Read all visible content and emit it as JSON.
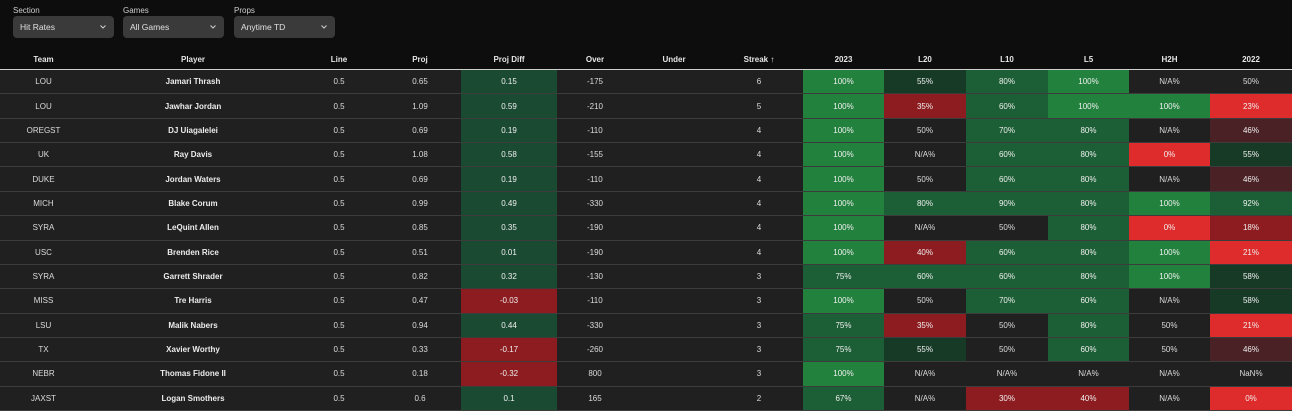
{
  "filters": [
    {
      "label": "Section",
      "value": "Hit Rates"
    },
    {
      "label": "Games",
      "value": "All Games"
    },
    {
      "label": "Props",
      "value": "Anytime TD"
    }
  ],
  "columns": [
    "Team",
    "Player",
    "Line",
    "Proj",
    "Proj Diff",
    "Over",
    "Under",
    "Streak ↑",
    "2023",
    "L20",
    "L10",
    "L5",
    "H2H",
    "2022"
  ],
  "colors": {
    "background": "#0d0d0d",
    "row": "#202020",
    "red_dark": "#4a2124",
    "red_mid": "#8c1c1f",
    "red_bright": "#de2b2b",
    "green_dark": "#173a27",
    "green_mid": "#1c5e35",
    "green_bright": "#22813d",
    "green_diff": "#1b4a33"
  },
  "rows": [
    {
      "team": "LOU",
      "player": "Jamari Thrash",
      "line": "0.5",
      "proj": "0.65",
      "diff": "0.15",
      "over": "-175",
      "under": "",
      "streak": "6",
      "y2023": "100%",
      "l20": "55%",
      "l10": "80%",
      "l5": "100%",
      "h2h": "N/A%",
      "y2022": "50%"
    },
    {
      "team": "LOU",
      "player": "Jawhar Jordan",
      "line": "0.5",
      "proj": "1.09",
      "diff": "0.59",
      "over": "-210",
      "under": "",
      "streak": "5",
      "y2023": "100%",
      "l20": "35%",
      "l10": "60%",
      "l5": "100%",
      "h2h": "100%",
      "y2022": "23%"
    },
    {
      "team": "OREGST",
      "player": "DJ Uiagalelei",
      "line": "0.5",
      "proj": "0.69",
      "diff": "0.19",
      "over": "-110",
      "under": "",
      "streak": "4",
      "y2023": "100%",
      "l20": "50%",
      "l10": "70%",
      "l5": "80%",
      "h2h": "N/A%",
      "y2022": "46%"
    },
    {
      "team": "UK",
      "player": "Ray Davis",
      "line": "0.5",
      "proj": "1.08",
      "diff": "0.58",
      "over": "-155",
      "under": "",
      "streak": "4",
      "y2023": "100%",
      "l20": "N/A%",
      "l10": "60%",
      "l5": "80%",
      "h2h": "0%",
      "y2022": "55%"
    },
    {
      "team": "DUKE",
      "player": "Jordan Waters",
      "line": "0.5",
      "proj": "0.69",
      "diff": "0.19",
      "over": "-110",
      "under": "",
      "streak": "4",
      "y2023": "100%",
      "l20": "50%",
      "l10": "60%",
      "l5": "80%",
      "h2h": "N/A%",
      "y2022": "46%"
    },
    {
      "team": "MICH",
      "player": "Blake Corum",
      "line": "0.5",
      "proj": "0.99",
      "diff": "0.49",
      "over": "-330",
      "under": "",
      "streak": "4",
      "y2023": "100%",
      "l20": "80%",
      "l10": "90%",
      "l5": "80%",
      "h2h": "100%",
      "y2022": "92%"
    },
    {
      "team": "SYRA",
      "player": "LeQuint Allen",
      "line": "0.5",
      "proj": "0.85",
      "diff": "0.35",
      "over": "-190",
      "under": "",
      "streak": "4",
      "y2023": "100%",
      "l20": "N/A%",
      "l10": "50%",
      "l5": "80%",
      "h2h": "0%",
      "y2022": "18%"
    },
    {
      "team": "USC",
      "player": "Brenden Rice",
      "line": "0.5",
      "proj": "0.51",
      "diff": "0.01",
      "over": "-190",
      "under": "",
      "streak": "4",
      "y2023": "100%",
      "l20": "40%",
      "l10": "60%",
      "l5": "80%",
      "h2h": "100%",
      "y2022": "21%"
    },
    {
      "team": "SYRA",
      "player": "Garrett Shrader",
      "line": "0.5",
      "proj": "0.82",
      "diff": "0.32",
      "over": "-130",
      "under": "",
      "streak": "3",
      "y2023": "75%",
      "l20": "60%",
      "l10": "60%",
      "l5": "80%",
      "h2h": "100%",
      "y2022": "58%"
    },
    {
      "team": "MISS",
      "player": "Tre Harris",
      "line": "0.5",
      "proj": "0.47",
      "diff": "-0.03",
      "over": "-110",
      "under": "",
      "streak": "3",
      "y2023": "100%",
      "l20": "50%",
      "l10": "70%",
      "l5": "60%",
      "h2h": "N/A%",
      "y2022": "58%"
    },
    {
      "team": "LSU",
      "player": "Malik Nabers",
      "line": "0.5",
      "proj": "0.94",
      "diff": "0.44",
      "over": "-330",
      "under": "",
      "streak": "3",
      "y2023": "75%",
      "l20": "35%",
      "l10": "50%",
      "l5": "80%",
      "h2h": "50%",
      "y2022": "21%"
    },
    {
      "team": "TX",
      "player": "Xavier Worthy",
      "line": "0.5",
      "proj": "0.33",
      "diff": "-0.17",
      "over": "-260",
      "under": "",
      "streak": "3",
      "y2023": "75%",
      "l20": "55%",
      "l10": "50%",
      "l5": "60%",
      "h2h": "50%",
      "y2022": "46%"
    },
    {
      "team": "NEBR",
      "player": "Thomas Fidone II",
      "line": "0.5",
      "proj": "0.18",
      "diff": "-0.32",
      "over": "800",
      "under": "",
      "streak": "3",
      "y2023": "100%",
      "l20": "N/A%",
      "l10": "N/A%",
      "l5": "N/A%",
      "h2h": "N/A%",
      "y2022": "NaN%"
    },
    {
      "team": "JAXST",
      "player": "Logan Smothers",
      "line": "0.5",
      "proj": "0.6",
      "diff": "0.1",
      "over": "165",
      "under": "",
      "streak": "2",
      "y2023": "67%",
      "l20": "N/A%",
      "l10": "30%",
      "l5": "40%",
      "h2h": "N/A%",
      "y2022": "0%"
    }
  ]
}
